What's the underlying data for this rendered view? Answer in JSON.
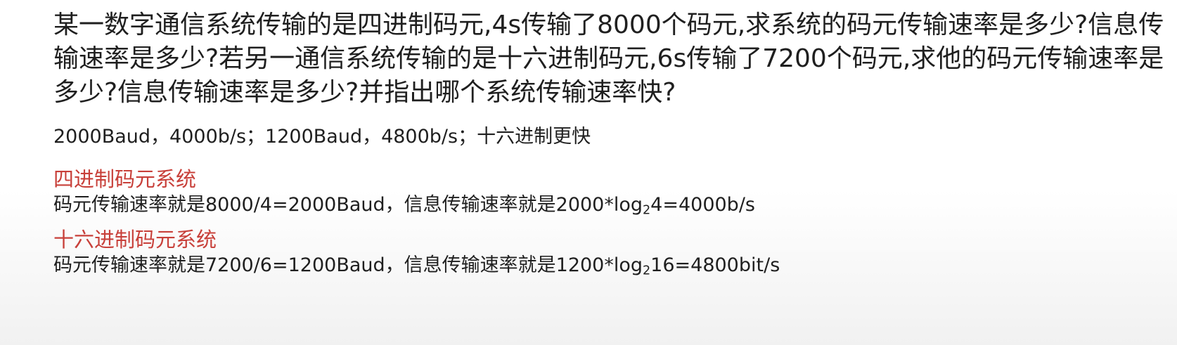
{
  "question": {
    "text": "某一数字通信系统传输的是四进制码元,4s传输了8000个码元,求系统的码元传输速率是多少?信息传输速率是多少?若另一通信系统传输的是十六进制码元,6s传输了7200个码元,求他的码元传输速率是多少?信息传输速率是多少?并指出哪个系统传输速率快?"
  },
  "answer": {
    "text": "2000Baud，4000b/s；1200Baud，4800b/s；十六进制更快"
  },
  "sections": [
    {
      "title": "四进制码元系统",
      "body_prefix": "码元传输速率就是8000/4=2000Baud，信息传输速率就是2000*log",
      "body_sub": "2",
      "body_suffix": "4=4000b/s"
    },
    {
      "title": "十六进制码元系统",
      "body_prefix": "码元传输速率就是7200/6=1200Baud，信息传输速率就是1200*log",
      "body_sub": "2",
      "body_suffix": "16=4800bit/s"
    }
  ],
  "colors": {
    "heading_red": "#c8403a",
    "text": "#1f1f1f"
  }
}
